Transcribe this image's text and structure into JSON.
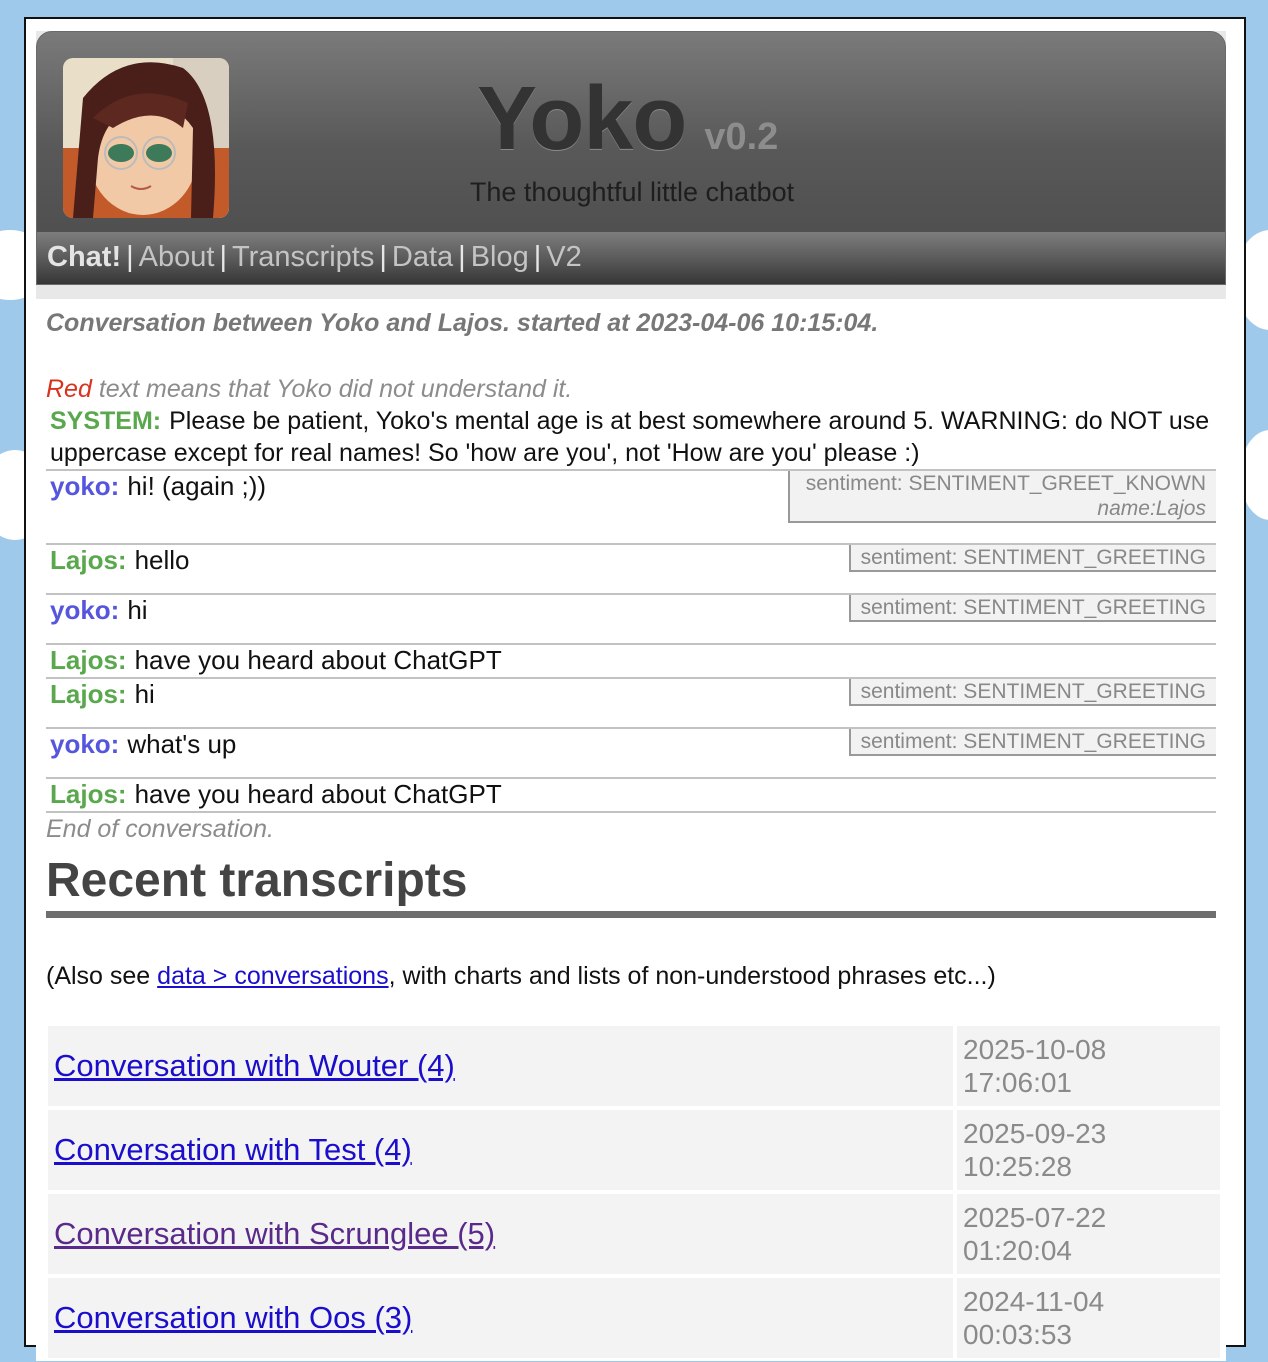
{
  "header": {
    "title": "Yoko",
    "version": "v0.2",
    "tagline": "The thoughtful little chatbot"
  },
  "nav": [
    {
      "label": "Chat!",
      "active": true
    },
    {
      "label": "About"
    },
    {
      "label": "Transcripts"
    },
    {
      "label": "Data"
    },
    {
      "label": "Blog"
    },
    {
      "label": "V2"
    }
  ],
  "conversation": {
    "title": "Conversation between Yoko and Lajos. started at 2023-04-06 10:15:04.",
    "red_word": "Red",
    "red_note": " text means that Yoko did not understand it.",
    "system_speaker": "SYSTEM:",
    "system_text": "Please be patient, Yoko's mental age is at best somewhere around 5. WARNING: do NOT use uppercase except for real names! So 'how are you', not 'How are you' please :)",
    "messages": [
      {
        "speaker": "yoko:",
        "text": "hi! (again ;))",
        "sentiment": "sentiment: SENTIMENT_GREET_KNOWN",
        "extra": "name:Lajos"
      },
      {
        "speaker": "Lajos:",
        "text": "hello",
        "sentiment": "sentiment: SENTIMENT_GREETING"
      },
      {
        "speaker": "yoko:",
        "text": "hi",
        "sentiment": "sentiment: SENTIMENT_GREETING"
      },
      {
        "speaker": "Lajos:",
        "text": "have you heard about ChatGPT"
      },
      {
        "speaker": "Lajos:",
        "text": "hi",
        "sentiment": "sentiment: SENTIMENT_GREETING"
      },
      {
        "speaker": "yoko:",
        "text": "what's up",
        "sentiment": "sentiment: SENTIMENT_GREETING"
      },
      {
        "speaker": "Lajos:",
        "text": "have you heard about ChatGPT"
      }
    ],
    "end": "End of conversation."
  },
  "recent": {
    "heading": "Recent transcripts",
    "also_prefix": "(Also see ",
    "also_link": "data > conversations",
    "also_suffix": ", with charts and lists of non-understood phrases etc...)",
    "items": [
      {
        "label": "Conversation with Wouter (4)",
        "date": "2025-10-08",
        "time": "17:06:01"
      },
      {
        "label": "Conversation with Test (4)",
        "date": "2025-09-23",
        "time": "10:25:28"
      },
      {
        "label": "Conversation with Scrunglee (5)",
        "date": "2025-07-22",
        "time": "01:20:04",
        "visited": true
      },
      {
        "label": "Conversation with Oos (3)",
        "date": "2024-11-04",
        "time": "00:03:53"
      }
    ]
  }
}
